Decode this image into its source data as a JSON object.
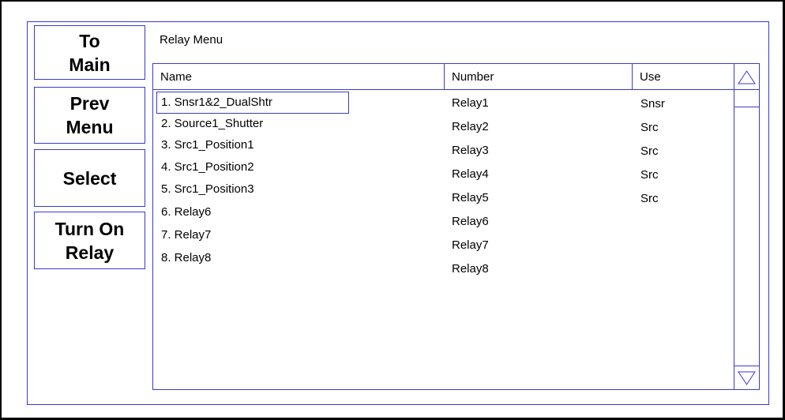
{
  "sidebar": {
    "to_main": "To\nMain",
    "prev_menu": "Prev\nMenu",
    "select": "Select",
    "turn_on_relay": "Turn On\nRelay"
  },
  "menu_title": "Relay Menu",
  "table": {
    "headers": {
      "name": "Name",
      "number": "Number",
      "use": "Use"
    },
    "names": [
      "1. Snsr1&2_DualShtr",
      "2. Source1_Shutter",
      "3. Src1_Position1",
      "4. Src1_Position2",
      "5. Src1_Position3",
      "6. Relay6",
      "7. Relay7",
      "8. Relay8"
    ],
    "numbers": [
      "Relay1",
      "Relay2",
      "Relay3",
      "Relay4",
      "Relay5",
      "Relay6",
      "Relay7",
      "Relay8"
    ],
    "uses": [
      "Snsr",
      "Src",
      "Src",
      "Src",
      "Src"
    ]
  },
  "colors": {
    "border": "#3a3ad0",
    "text": "#000000",
    "background": "#ffffff"
  },
  "icons": {
    "scroll_up": "triangle-up-icon",
    "scroll_down": "triangle-down-icon"
  }
}
